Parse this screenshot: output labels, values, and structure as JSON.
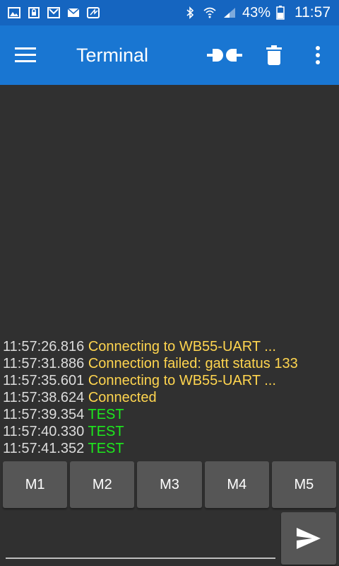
{
  "status_bar": {
    "left_icons": [
      "image-icon",
      "lock-icon",
      "gmail-icon",
      "mail-icon",
      "nfc-icon"
    ],
    "right_icons": [
      "bluetooth-icon",
      "wifi-icon",
      "signal-icon"
    ],
    "battery": "43%",
    "time": "11:57"
  },
  "app_bar": {
    "title": "Terminal",
    "icons": [
      "menu-icon",
      "connect-icon",
      "delete-icon",
      "overflow-icon"
    ]
  },
  "colors": {
    "status_bar": "#1565c0",
    "app_bar": "#1976d2",
    "background": "#303030",
    "status_text": "#ffd54f",
    "received_text": "#1de91d",
    "button": "#565656"
  },
  "log": [
    {
      "time": "11:57:26.816",
      "text": "Connecting to WB55-UART ...",
      "kind": "status"
    },
    {
      "time": "11:57:31.886",
      "text": "Connection failed: gatt status 133",
      "kind": "status"
    },
    {
      "time": "11:57:35.601",
      "text": "Connecting to WB55-UART ...",
      "kind": "status"
    },
    {
      "time": "11:57:38.624",
      "text": "Connected",
      "kind": "status"
    },
    {
      "time": "11:57:39.354",
      "text": "TEST",
      "kind": "received"
    },
    {
      "time": "11:57:40.330",
      "text": "TEST",
      "kind": "received"
    },
    {
      "time": "11:57:41.352",
      "text": "TEST",
      "kind": "received"
    }
  ],
  "macros": [
    "M1",
    "M2",
    "M3",
    "M4",
    "M5"
  ],
  "input": {
    "value": "",
    "placeholder": ""
  },
  "send": {
    "icon": "send-icon"
  }
}
